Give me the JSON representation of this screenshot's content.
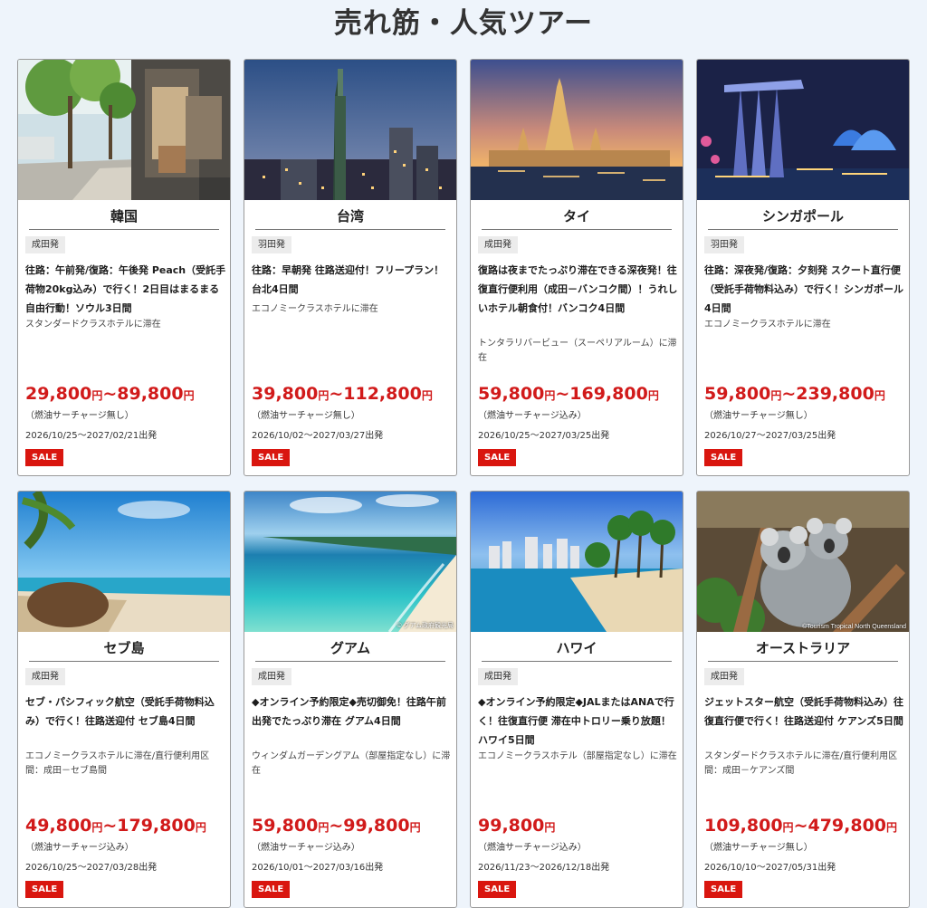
{
  "page": {
    "title": "売れ筋・人気ツアー"
  },
  "cards": [
    {
      "destination": "韓国",
      "departure": "成田発",
      "title": "往路：午前発/復路：午後発 Peach（受託手荷物20kg込み）で行く！2日目はまるまる自由行動！ソウル3日間",
      "hotel": "スタンダードクラスホテルに滞在",
      "price_min": "29,800",
      "price_max": "89,800",
      "yen": "円",
      "tilde": "~",
      "surcharge": "（燃油サーチャージ無し）",
      "period": "2026/10/25～2027/02/21出発",
      "badge": "SALE",
      "scene": "street"
    },
    {
      "destination": "台湾",
      "departure": "羽田発",
      "title": "往路：早朝発 往路送迎付！フリープラン！台北4日間",
      "hotel": "エコノミークラスホテルに滞在",
      "price_min": "39,800",
      "price_max": "112,800",
      "yen": "円",
      "tilde": "~",
      "surcharge": "（燃油サーチャージ無し）",
      "period": "2026/10/02～2027/03/27出発",
      "badge": "SALE",
      "scene": "taipei"
    },
    {
      "destination": "タイ",
      "departure": "成田発",
      "title": "復路は夜までたっぷり滞在できる深夜発！往復直行便利用（成田－バンコク間）！うれしいホテル朝食付！バンコク4日間",
      "hotel": "トンタラリバービュー（スーペリアルーム）に滞在",
      "price_min": "59,800",
      "price_max": "169,800",
      "yen": "円",
      "tilde": "~",
      "surcharge": "（燃油サーチャージ込み）",
      "period": "2026/10/25～2027/03/25出発",
      "badge": "SALE",
      "scene": "temple"
    },
    {
      "destination": "シンガポール",
      "departure": "羽田発",
      "title": "往路：深夜発/復路：夕刻発 スクート直行便（受託手荷物料込み）で行く！シンガポール4日間",
      "hotel": "エコノミークラスホテルに滞在",
      "price_min": "59,800",
      "price_max": "239,800",
      "yen": "円",
      "tilde": "~",
      "surcharge": "（燃油サーチャージ無し）",
      "period": "2026/10/27～2027/03/25出発",
      "badge": "SALE",
      "scene": "marina"
    },
    {
      "destination": "セブ島",
      "departure": "成田発",
      "title": "セブ・パシフィック航空（受託手荷物料込み）で行く！往路送迎付 セブ島4日間",
      "hotel": "エコノミークラスホテルに滞在/直行便利用区間：成田－セブ島間",
      "price_min": "49,800",
      "price_max": "179,800",
      "yen": "円",
      "tilde": "~",
      "surcharge": "（燃油サーチャージ込み）",
      "period": "2026/10/25～2027/03/28出発",
      "badge": "SALE",
      "scene": "beach"
    },
    {
      "destination": "グアム",
      "departure": "成田発",
      "title": "◆オンライン予約限定◆売切御免！往路午前出発でたっぷり滞在 グアム4日間",
      "hotel": "ウィンダムガーデングアム（部屋指定なし）に滞在",
      "price_min": "59,800",
      "price_max": "99,800",
      "yen": "円",
      "tilde": "~",
      "surcharge": "（燃油サーチャージ込み）",
      "period": "2026/10/01～2027/03/16出発",
      "badge": "SALE",
      "scene": "lagoon",
      "credit": "© グアム政府観光局"
    },
    {
      "destination": "ハワイ",
      "departure": "成田発",
      "title": "◆オンライン予約限定◆JALまたはANAで行く！往復直行便 滞在中トロリー乗り放題！ハワイ5日間",
      "hotel": "エコノミークラスホテル（部屋指定なし）に滞在",
      "price_min": "99,800",
      "price_max": "",
      "yen": "円",
      "tilde": "",
      "surcharge": "（燃油サーチャージ込み）",
      "period": "2026/11/23～2026/12/18出発",
      "badge": "SALE",
      "scene": "waikiki"
    },
    {
      "destination": "オーストラリア",
      "departure": "成田発",
      "title": "ジェットスター航空（受託手荷物料込み）往復直行便で行く！往路送迎付 ケアンズ5日間",
      "hotel": "スタンダードクラスホテルに滞在/直行便利用区間：成田－ケアンズ間",
      "price_min": "109,800",
      "price_max": "479,800",
      "yen": "円",
      "tilde": "~",
      "surcharge": "（燃油サーチャージ無し）",
      "period": "2026/10/10～2027/05/31出発",
      "badge": "SALE",
      "scene": "koala",
      "credit": "©Tourism Tropical North Queensland"
    }
  ]
}
